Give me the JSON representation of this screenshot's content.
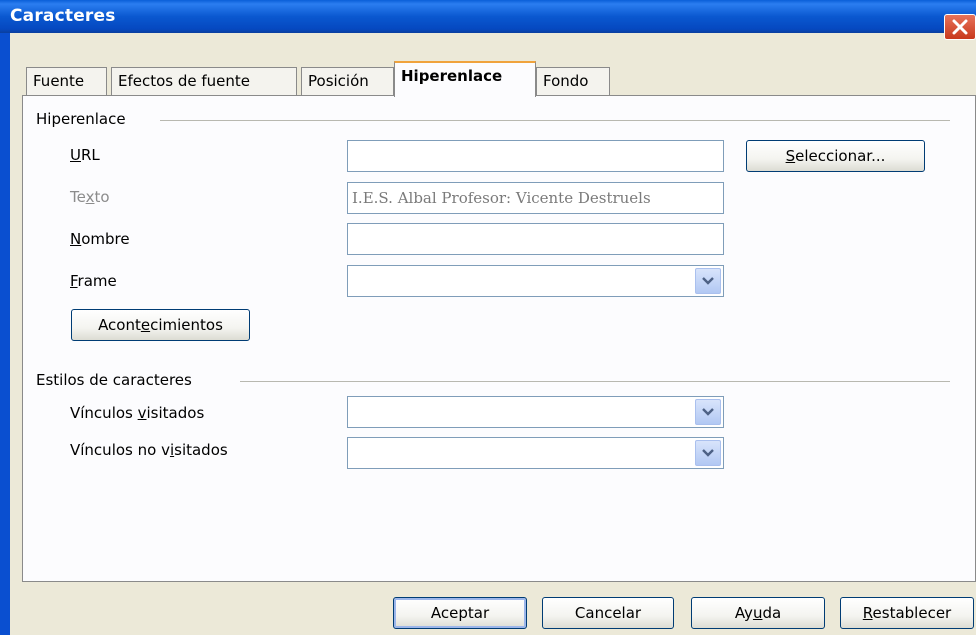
{
  "window": {
    "title": "Caracteres"
  },
  "tabs": [
    {
      "label": "Fuente",
      "active": false
    },
    {
      "label": "Efectos de fuente",
      "active": false
    },
    {
      "label": "Posición",
      "active": false
    },
    {
      "label": "Hiperenlace",
      "active": true
    },
    {
      "label": "Fondo",
      "active": false
    }
  ],
  "hyperlink": {
    "section_title": "Hiperenlace",
    "url": {
      "label_u": "U",
      "label_rest": "RL",
      "value": ""
    },
    "text": {
      "label_pre": "Te",
      "label_u": "x",
      "label_post": "to",
      "value": "I.E.S. Albal  Profesor: Vicente Destruels",
      "disabled": true
    },
    "name": {
      "label_u": "N",
      "label_rest": "ombre",
      "value": ""
    },
    "frame": {
      "label_u": "F",
      "label_rest": "rame",
      "value": ""
    },
    "select_button": {
      "label_u": "S",
      "label_rest": "eleccionar..."
    },
    "events_button": {
      "label_pre": "Acont",
      "label_u": "e",
      "label_post": "cimientos"
    }
  },
  "char_styles": {
    "section_title": "Estilos de caracteres",
    "visited": {
      "label_pre": "Vínculos ",
      "label_u": "v",
      "label_post": "isitados",
      "value": ""
    },
    "unvisited": {
      "label_pre": "Vínculos no v",
      "label_u": "i",
      "label_post": "sitados",
      "value": ""
    }
  },
  "footer": {
    "ok": "Aceptar",
    "cancel": "Cancelar",
    "help_pre": "Ay",
    "help_u": "u",
    "help_post": "da",
    "reset_u": "R",
    "reset_rest": "establecer"
  },
  "colors": {
    "titlebar": "#0a58d0",
    "active_tab_accent": "#f0a33c",
    "dialog_bg": "#ece9d8"
  }
}
